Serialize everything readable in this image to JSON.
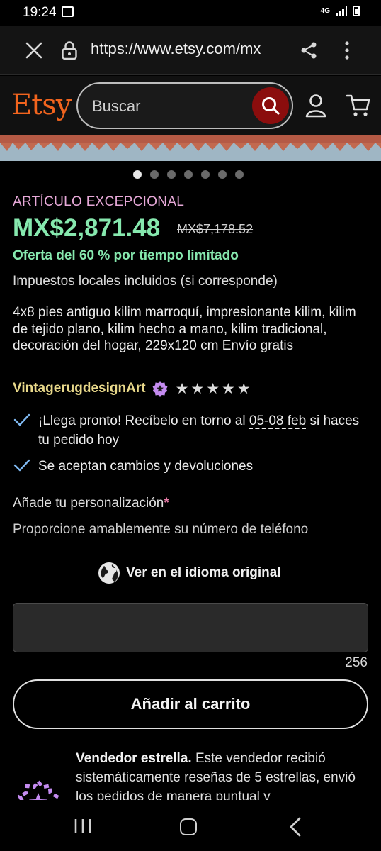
{
  "status_bar": {
    "time": "19:24",
    "network": "4G",
    "icons": [
      "gallery-icon",
      "signal-icon",
      "battery-icon"
    ]
  },
  "browser": {
    "url": "https://www.etsy.com/mx",
    "icons": [
      "close-icon",
      "lock-icon",
      "share-icon",
      "more-vert-icon"
    ]
  },
  "header": {
    "logo": "Etsy",
    "search_placeholder": "Buscar",
    "colors": {
      "logo": "#f1641e",
      "search_button": "#8b0d0d"
    }
  },
  "carousel": {
    "total": 7,
    "active": 1
  },
  "product": {
    "special_label": "ARTÍCULO EXCEPCIONAL",
    "price": "MX$2,871.48",
    "original_price": "MX$7,178.52",
    "offer": "Oferta del 60 % por tiempo limitado",
    "taxes": "Impuestos locales incluidos (si corresponde)",
    "title": "4x8 pies antiguo kilim marroquí, impresionante kilim, kilim de tejido plano, kilim hecho a mano, kilim tradicional, decoración del hogar, 229x120 cm Envío gratis",
    "seller": "VintagerugdesignArt",
    "rating_stars": 5
  },
  "delivery": {
    "arrive_prefix": "¡Llega pronto! Recíbelo en torno al",
    "arrive_date": "05-08 feb",
    "arrive_suffix": "si haces tu pedido hoy",
    "returns": "Se aceptan cambios y devoluciones"
  },
  "personalization": {
    "label": "Añade tu personalización",
    "required_mark": "*",
    "hint": "Proporcione amablemente su número de teléfono",
    "translate": "Ver en el idioma original",
    "input_value": "",
    "char_count": "256"
  },
  "actions": {
    "add_to_cart": "Añadir al carrito"
  },
  "star_seller": {
    "title": "Vendedor estrella.",
    "text": "Este vendedor recibió sistemáticamente reseñas de 5 estrellas, envió los pedidos de manera puntual y"
  },
  "nav": {
    "icons": [
      "recent-apps-icon",
      "home-icon",
      "back-icon"
    ]
  }
}
